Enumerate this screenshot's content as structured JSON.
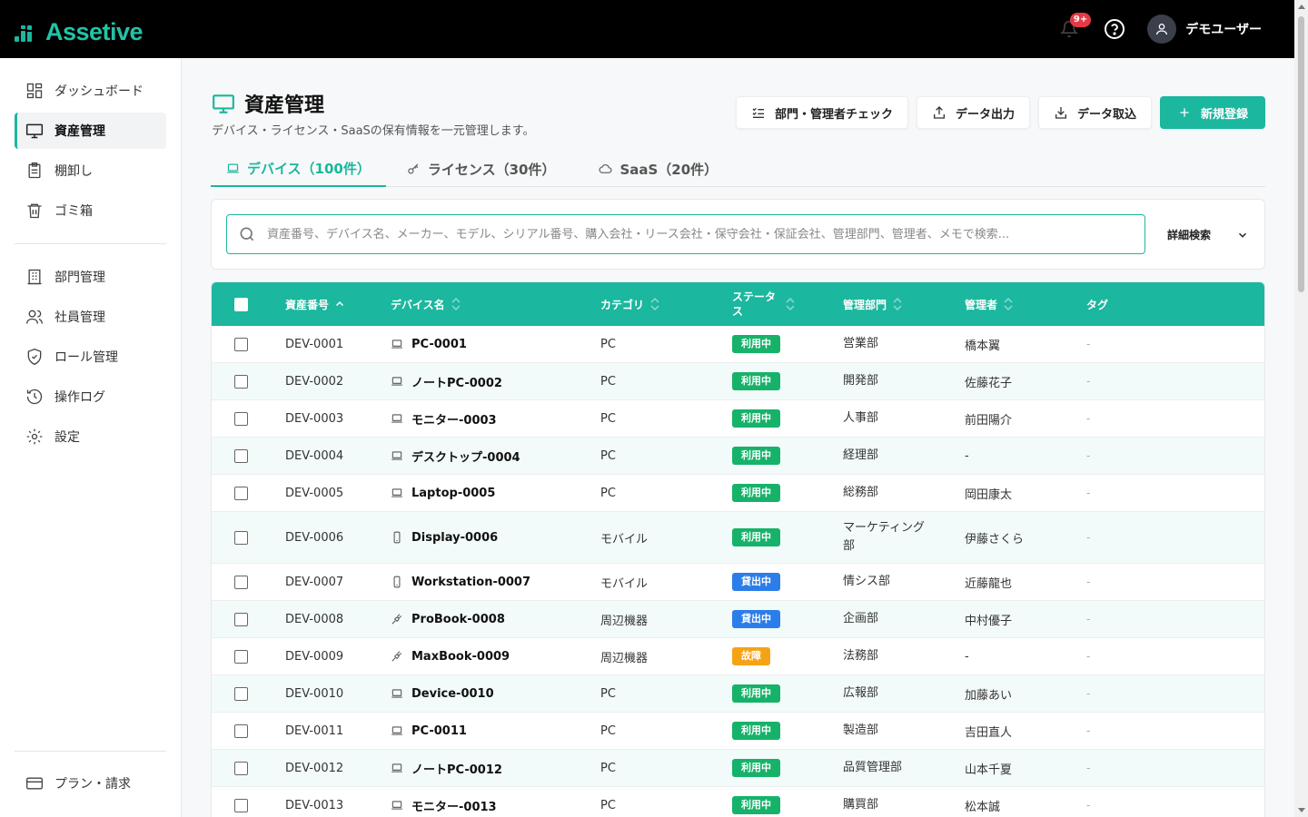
{
  "app": {
    "name": "Assetive",
    "notif_count": "9+",
    "user_name": "デモユーザー",
    "accent": "#1bb79e"
  },
  "sidebar": {
    "items": [
      {
        "label": "ダッシュボード",
        "icon": "dashboard-icon",
        "active": false
      },
      {
        "label": "資産管理",
        "icon": "monitor-icon",
        "active": true
      },
      {
        "label": "棚卸し",
        "icon": "clipboard-icon",
        "active": false
      },
      {
        "label": "ゴミ箱",
        "icon": "trash-icon",
        "active": false
      },
      {
        "label": "部門管理",
        "icon": "building-icon",
        "active": false
      },
      {
        "label": "社員管理",
        "icon": "users-icon",
        "active": false
      },
      {
        "label": "ロール管理",
        "icon": "shield-icon",
        "active": false
      },
      {
        "label": "操作ログ",
        "icon": "history-icon",
        "active": false
      },
      {
        "label": "設定",
        "icon": "gear-icon",
        "active": false
      }
    ],
    "footer_label": "プラン・請求"
  },
  "page": {
    "title": "資産管理",
    "subtitle": "デバイス・ライセンス・SaaSの保有情報を一元管理します。"
  },
  "actions": {
    "check": "部門・管理者チェック",
    "export": "データ出力",
    "import": "データ取込",
    "create": "新規登録"
  },
  "tabs": [
    {
      "label": "デバイス（100件）",
      "active": true
    },
    {
      "label": "ライセンス（30件）",
      "active": false
    },
    {
      "label": "SaaS（20件）",
      "active": false
    }
  ],
  "search": {
    "placeholder": "資産番号、デバイス名、メーカー、モデル、シリアル番号、購入会社・リース会社・保守会社・保証会社、管理部門、管理者、メモで検索...",
    "advanced_label": "詳細検索"
  },
  "table": {
    "headers": {
      "asset_no": "資産番号",
      "device_name": "デバイス名",
      "category": "カテゴリ",
      "status": "ステータス",
      "department": "管理部門",
      "manager": "管理者",
      "tag": "タグ"
    },
    "status_colors": {
      "利用中": "#17b26a",
      "貸出中": "#2b7de9",
      "故障": "#f5a315"
    },
    "rows": [
      {
        "asset_no": "DEV-0001",
        "name": "PC-0001",
        "icon": "laptop-icon",
        "category": "PC",
        "status": "利用中",
        "dept": "営業部",
        "manager": "橋本翼",
        "tag": "-"
      },
      {
        "asset_no": "DEV-0002",
        "name": "ノートPC-0002",
        "icon": "laptop-icon",
        "category": "PC",
        "status": "利用中",
        "dept": "開発部",
        "manager": "佐藤花子",
        "tag": "-"
      },
      {
        "asset_no": "DEV-0003",
        "name": "モニター-0003",
        "icon": "laptop-icon",
        "category": "PC",
        "status": "利用中",
        "dept": "人事部",
        "manager": "前田陽介",
        "tag": "-"
      },
      {
        "asset_no": "DEV-0004",
        "name": "デスクトップ-0004",
        "icon": "laptop-icon",
        "category": "PC",
        "status": "利用中",
        "dept": "経理部",
        "manager": "-",
        "tag": "-"
      },
      {
        "asset_no": "DEV-0005",
        "name": "Laptop-0005",
        "icon": "laptop-icon",
        "category": "PC",
        "status": "利用中",
        "dept": "総務部",
        "manager": "岡田康太",
        "tag": "-"
      },
      {
        "asset_no": "DEV-0006",
        "name": "Display-0006",
        "icon": "phone-icon",
        "category": "モバイル",
        "status": "利用中",
        "dept": "マーケティング部",
        "manager": "伊藤さくら",
        "tag": "-"
      },
      {
        "asset_no": "DEV-0007",
        "name": "Workstation-0007",
        "icon": "phone-icon",
        "category": "モバイル",
        "status": "貸出中",
        "dept": "情シス部",
        "manager": "近藤龍也",
        "tag": "-"
      },
      {
        "asset_no": "DEV-0008",
        "name": "ProBook-0008",
        "icon": "plug-icon",
        "category": "周辺機器",
        "status": "貸出中",
        "dept": "企画部",
        "manager": "中村優子",
        "tag": "-"
      },
      {
        "asset_no": "DEV-0009",
        "name": "MaxBook-0009",
        "icon": "plug-icon",
        "category": "周辺機器",
        "status": "故障",
        "dept": "法務部",
        "manager": "-",
        "tag": "-"
      },
      {
        "asset_no": "DEV-0010",
        "name": "Device-0010",
        "icon": "laptop-icon",
        "category": "PC",
        "status": "利用中",
        "dept": "広報部",
        "manager": "加藤あい",
        "tag": "-"
      },
      {
        "asset_no": "DEV-0011",
        "name": "PC-0011",
        "icon": "laptop-icon",
        "category": "PC",
        "status": "利用中",
        "dept": "製造部",
        "manager": "吉田直人",
        "tag": "-"
      },
      {
        "asset_no": "DEV-0012",
        "name": "ノートPC-0012",
        "icon": "laptop-icon",
        "category": "PC",
        "status": "利用中",
        "dept": "品質管理部",
        "manager": "山本千夏",
        "tag": "-"
      },
      {
        "asset_no": "DEV-0013",
        "name": "モニター-0013",
        "icon": "laptop-icon",
        "category": "PC",
        "status": "利用中",
        "dept": "購買部",
        "manager": "松本誠",
        "tag": "-"
      }
    ]
  }
}
